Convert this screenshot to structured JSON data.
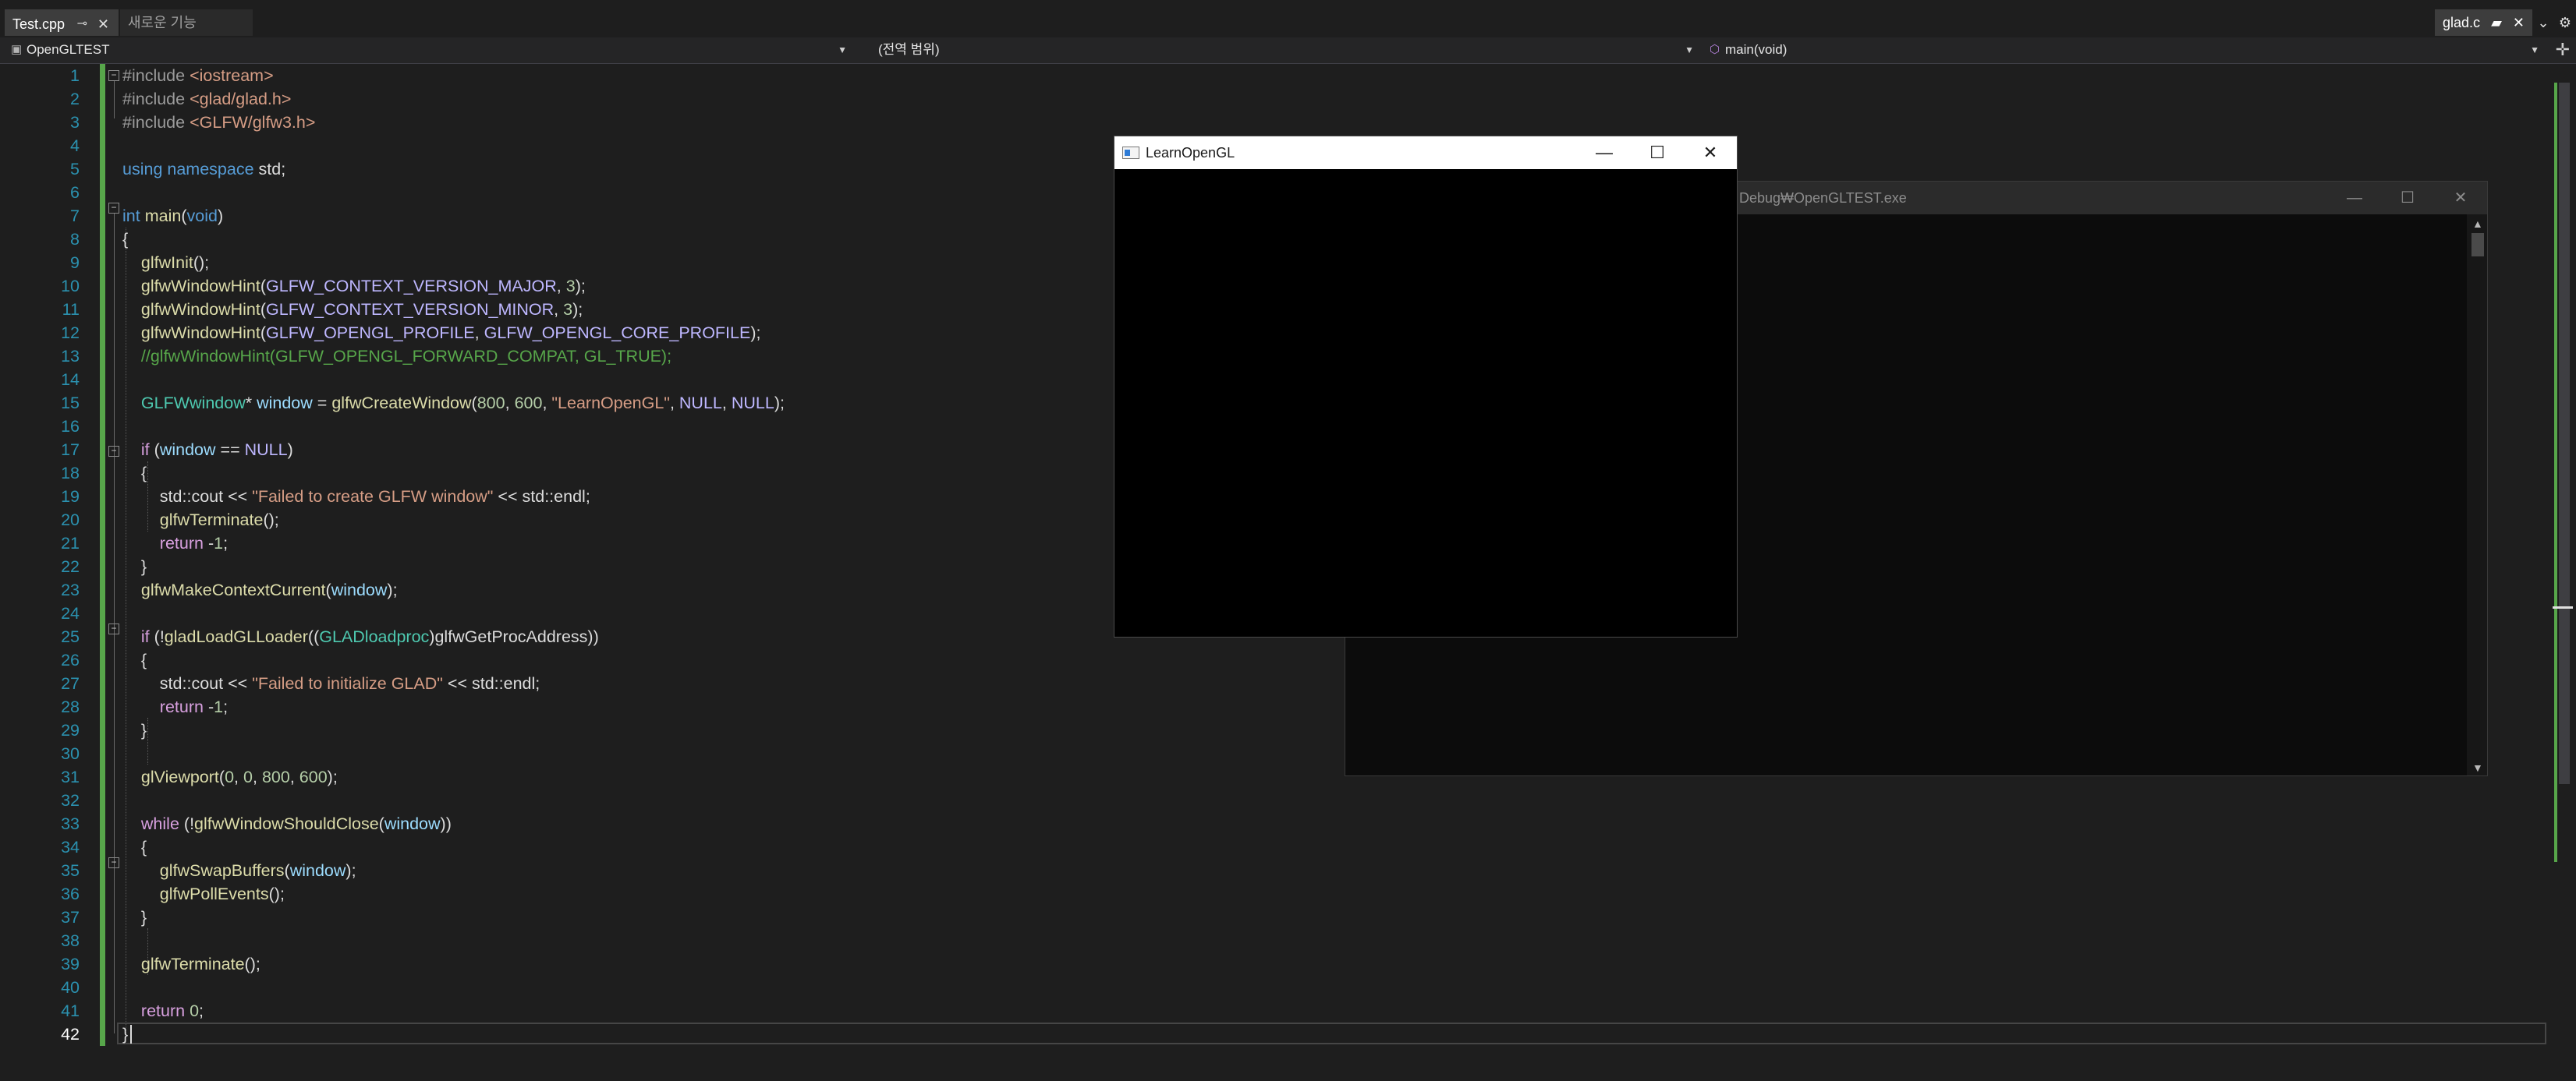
{
  "tabs": [
    {
      "label": "Test.cpp",
      "active": true
    },
    {
      "label": "새로운 기능",
      "active": false
    }
  ],
  "right_tab": {
    "label": "glad.c"
  },
  "nav": {
    "project": "OpenGLTEST",
    "scope": "(전역 범위)",
    "member": "main(void)"
  },
  "current_line": 42,
  "code_lines": [
    "#include <iostream>",
    "#include <glad/glad.h>",
    "#include <GLFW/glfw3.h>",
    "",
    "using namespace std;",
    "",
    "int main(void)",
    "{",
    "    glfwInit();",
    "    glfwWindowHint(GLFW_CONTEXT_VERSION_MAJOR, 3);",
    "    glfwWindowHint(GLFW_CONTEXT_VERSION_MINOR, 3);",
    "    glfwWindowHint(GLFW_OPENGL_PROFILE, GLFW_OPENGL_CORE_PROFILE);",
    "    //glfwWindowHint(GLFW_OPENGL_FORWARD_COMPAT, GL_TRUE);",
    "",
    "    GLFWwindow* window = glfwCreateWindow(800, 600, \"LearnOpenGL\", NULL, NULL);",
    "",
    "    if (window == NULL)",
    "    {",
    "        std::cout << \"Failed to create GLFW window\" << std::endl;",
    "        glfwTerminate();",
    "        return -1;",
    "    }",
    "    glfwMakeContextCurrent(window);",
    "",
    "    if (!gladLoadGLLoader((GLADloadproc)glfwGetProcAddress))",
    "    {",
    "        std::cout << \"Failed to initialize GLAD\" << std::endl;",
    "        return -1;",
    "    }",
    "",
    "    glViewport(0, 0, 800, 600);",
    "",
    "    while (!glfwWindowShouldClose(window))",
    "    {",
    "        glfwSwapBuffers(window);",
    "        glfwPollEvents();",
    "    }",
    "",
    "    glfwTerminate();",
    "",
    "    return 0;",
    "}"
  ],
  "gl_window": {
    "title": "LearnOpenGL",
    "minimize": "—",
    "maximize": "☐",
    "close": "✕"
  },
  "console_window": {
    "title": "Debug₩OpenGLTEST.exe",
    "minimize": "—",
    "maximize": "☐",
    "close": "✕"
  },
  "colors": {
    "editor_bg": "#1e1e1e",
    "line_number": "#2b91af",
    "keyword": "#569cd6",
    "function": "#dcdcaa",
    "macro": "#beb7ff",
    "type": "#4ec9b0",
    "string": "#d69d85",
    "comment": "#57a64a",
    "change_bar": "#57a64a"
  }
}
